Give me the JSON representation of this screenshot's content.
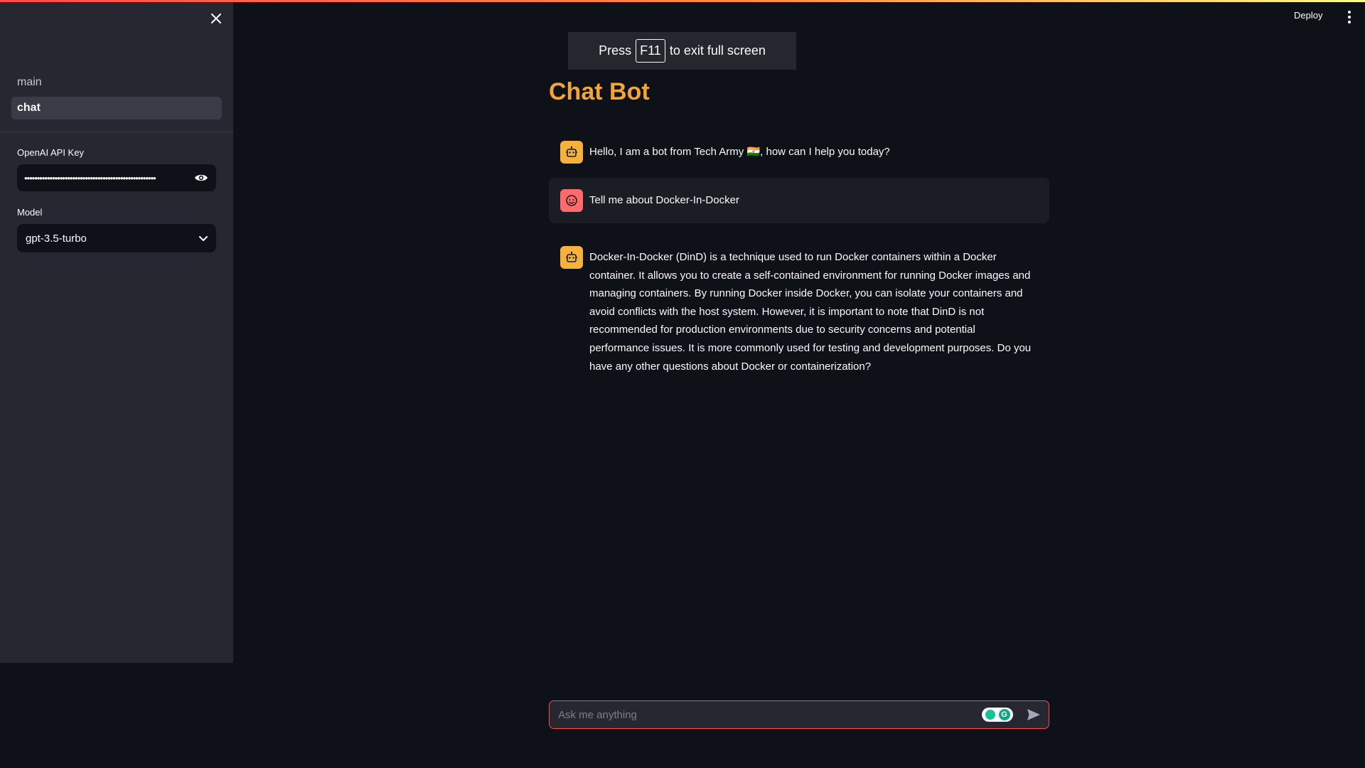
{
  "sidebar": {
    "nav": [
      {
        "label": "main"
      },
      {
        "label": "chat"
      }
    ],
    "api_key": {
      "label": "OpenAI API Key",
      "value": "••••••••••••••••••••••••••••••••••••••••••••••••••••"
    },
    "model": {
      "label": "Model",
      "value": "gpt-3.5-turbo"
    }
  },
  "header": {
    "deploy_label": "Deploy"
  },
  "fullscreen_notice": {
    "prefix": "Press",
    "key": "F11",
    "suffix": "to exit full screen"
  },
  "main": {
    "title": "Chat Bot",
    "messages": [
      {
        "role": "assistant",
        "text": "Hello, I am a bot from Tech Army 🇮🇳, how can I help you today?"
      },
      {
        "role": "user",
        "text": "Tell me about Docker-In-Docker"
      },
      {
        "role": "assistant",
        "text": "Docker-In-Docker (DinD) is a technique used to run Docker containers within a Docker container. It allows you to create a self-contained environment for running Docker images and managing containers. By running Docker inside Docker, you can isolate your containers and avoid conflicts with the host system. However, it is important to note that DinD is not recommended for production environments due to security concerns and potential performance issues. It is more commonly used for testing and development purposes. Do you have any other questions about Docker or containerization?"
      }
    ]
  },
  "chat_input": {
    "placeholder": "Ask me anything",
    "value": ""
  },
  "icons": {
    "close": "close-icon",
    "eye": "eye-icon",
    "chevron": "chevron-down-icon",
    "kebab": "kebab-menu-icon",
    "bot": "bot-icon",
    "user": "user-face-icon",
    "send": "send-icon"
  },
  "colors": {
    "accent": "#ff4b4b",
    "title": "#f4a437",
    "bot_avatar": "#f6b13c",
    "user_avatar": "#ff6b6b"
  }
}
